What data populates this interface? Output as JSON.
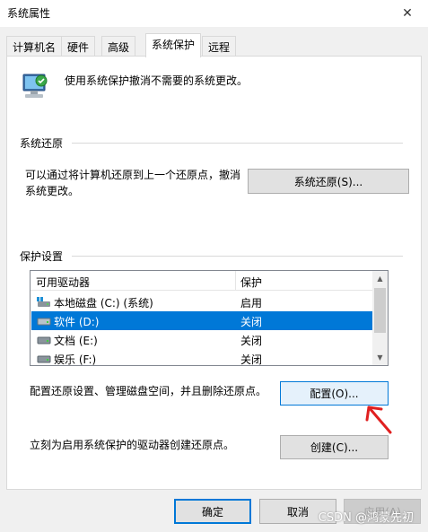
{
  "window": {
    "title": "系统属性",
    "close": "✕"
  },
  "tabs": [
    {
      "label": "计算机名"
    },
    {
      "label": "硬件"
    },
    {
      "label": "高级"
    },
    {
      "label": "系统保护"
    },
    {
      "label": "远程"
    }
  ],
  "intro": {
    "text": "使用系统保护撤消不需要的系统更改。"
  },
  "restore": {
    "heading": "系统还原",
    "desc_line1": "可以通过将计算机还原到上一个还原点，撤消",
    "desc_line2": "系统更改。",
    "button": "系统还原(S)..."
  },
  "protection": {
    "heading": "保护设置",
    "columns": [
      "可用驱动器",
      "保护"
    ],
    "rows": [
      {
        "name": "本地磁盘 (C:) (系统)",
        "status": "启用",
        "icon": "system-drive-icon"
      },
      {
        "name": "软件 (D:)",
        "status": "关闭",
        "icon": "drive-icon"
      },
      {
        "name": "文档 (E:)",
        "status": "关闭",
        "icon": "drive-icon"
      },
      {
        "name": "娱乐 (F:)",
        "status": "关闭",
        "icon": "drive-icon"
      }
    ],
    "selected_index": 1,
    "configure_desc": "配置还原设置、管理磁盘空间，并且删除还原点。",
    "configure_button": "配置(O)...",
    "create_desc": "立刻为启用系统保护的驱动器创建还原点。",
    "create_button": "创建(C)..."
  },
  "footer": {
    "ok": "确定",
    "cancel": "取消",
    "apply": "应用(A)"
  },
  "watermark": "CSDN @鸿蒙先初",
  "colors": {
    "selection": "#0078d7",
    "annotation_arrow": "#e02020"
  }
}
